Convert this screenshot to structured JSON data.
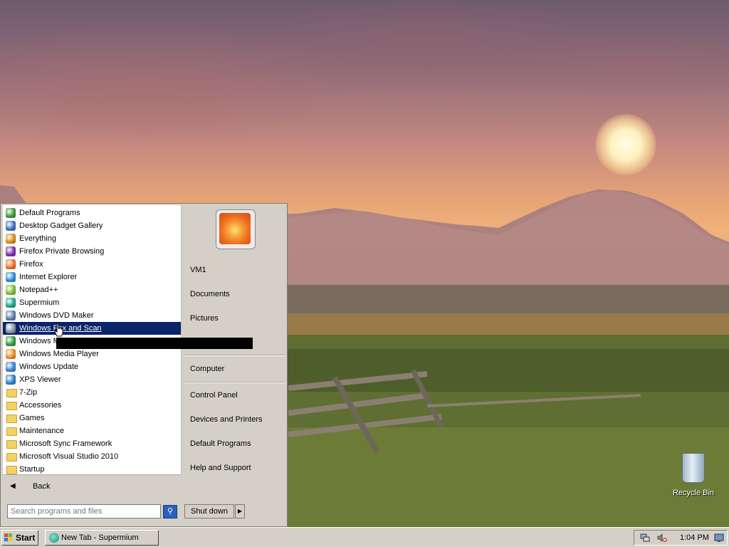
{
  "start_menu": {
    "programs": [
      {
        "label": "Default Programs",
        "icon": "default-programs-icon",
        "color": "#3b9a3b"
      },
      {
        "label": "Desktop Gadget Gallery",
        "icon": "gadget-gallery-icon",
        "color": "#3a6fc7"
      },
      {
        "label": "Everything",
        "icon": "magnifier-icon",
        "color": "#e08b14"
      },
      {
        "label": "Firefox Private Browsing",
        "icon": "firefox-private-icon",
        "color": "#7b2db0"
      },
      {
        "label": "Firefox",
        "icon": "firefox-icon",
        "color": "#f36e1f"
      },
      {
        "label": "Internet Explorer",
        "icon": "internet-explorer-icon",
        "color": "#2a8ed6"
      },
      {
        "label": "Notepad++",
        "icon": "notepadpp-icon",
        "color": "#7bbf3a"
      },
      {
        "label": "Supermium",
        "icon": "supermium-icon",
        "color": "#1aa88a"
      },
      {
        "label": "Windows DVD Maker",
        "icon": "dvd-maker-icon",
        "color": "#5a7fa8"
      },
      {
        "label": "Windows Fax and Scan",
        "icon": "fax-scan-icon",
        "color": "#8a98a8",
        "selected": true
      },
      {
        "label": "Windows Media Center",
        "icon": "media-center-icon",
        "color": "#2f9b3a"
      },
      {
        "label": "Windows Media Player",
        "icon": "media-player-icon",
        "color": "#f08a24"
      },
      {
        "label": "Windows Update",
        "icon": "windows-update-icon",
        "color": "#3c7ed8"
      },
      {
        "label": "XPS Viewer",
        "icon": "xps-viewer-icon",
        "color": "#2c7fc9"
      },
      {
        "label": "7-Zip",
        "icon": "folder-icon",
        "folder": true
      },
      {
        "label": "Accessories",
        "icon": "folder-icon",
        "folder": true
      },
      {
        "label": "Games",
        "icon": "folder-icon",
        "folder": true
      },
      {
        "label": "Maintenance",
        "icon": "folder-icon",
        "folder": true
      },
      {
        "label": "Microsoft Sync Framework",
        "icon": "folder-icon",
        "folder": true
      },
      {
        "label": "Microsoft Visual Studio 2010",
        "icon": "folder-icon",
        "folder": true
      },
      {
        "label": "Startup",
        "icon": "folder-icon",
        "folder": true
      }
    ],
    "back_label": "Back",
    "search_placeholder": "Search programs and files",
    "right_items": {
      "user": "VM1",
      "documents": "Documents",
      "pictures": "Pictures",
      "computer": "Computer",
      "control_panel": "Control Panel",
      "devices_printers": "Devices and Printers",
      "default_programs": "Default Programs",
      "help_support": "Help and Support"
    },
    "shutdown_label": "Shut down"
  },
  "desktop": {
    "recycle_bin_label": "Recycle Bin"
  },
  "taskbar": {
    "start_label": "Start",
    "task_label": "New Tab - Supermium",
    "clock": "1:04 PM"
  },
  "colors": {
    "selection": "#0a246a",
    "menu_face": "#d4d0c8"
  }
}
